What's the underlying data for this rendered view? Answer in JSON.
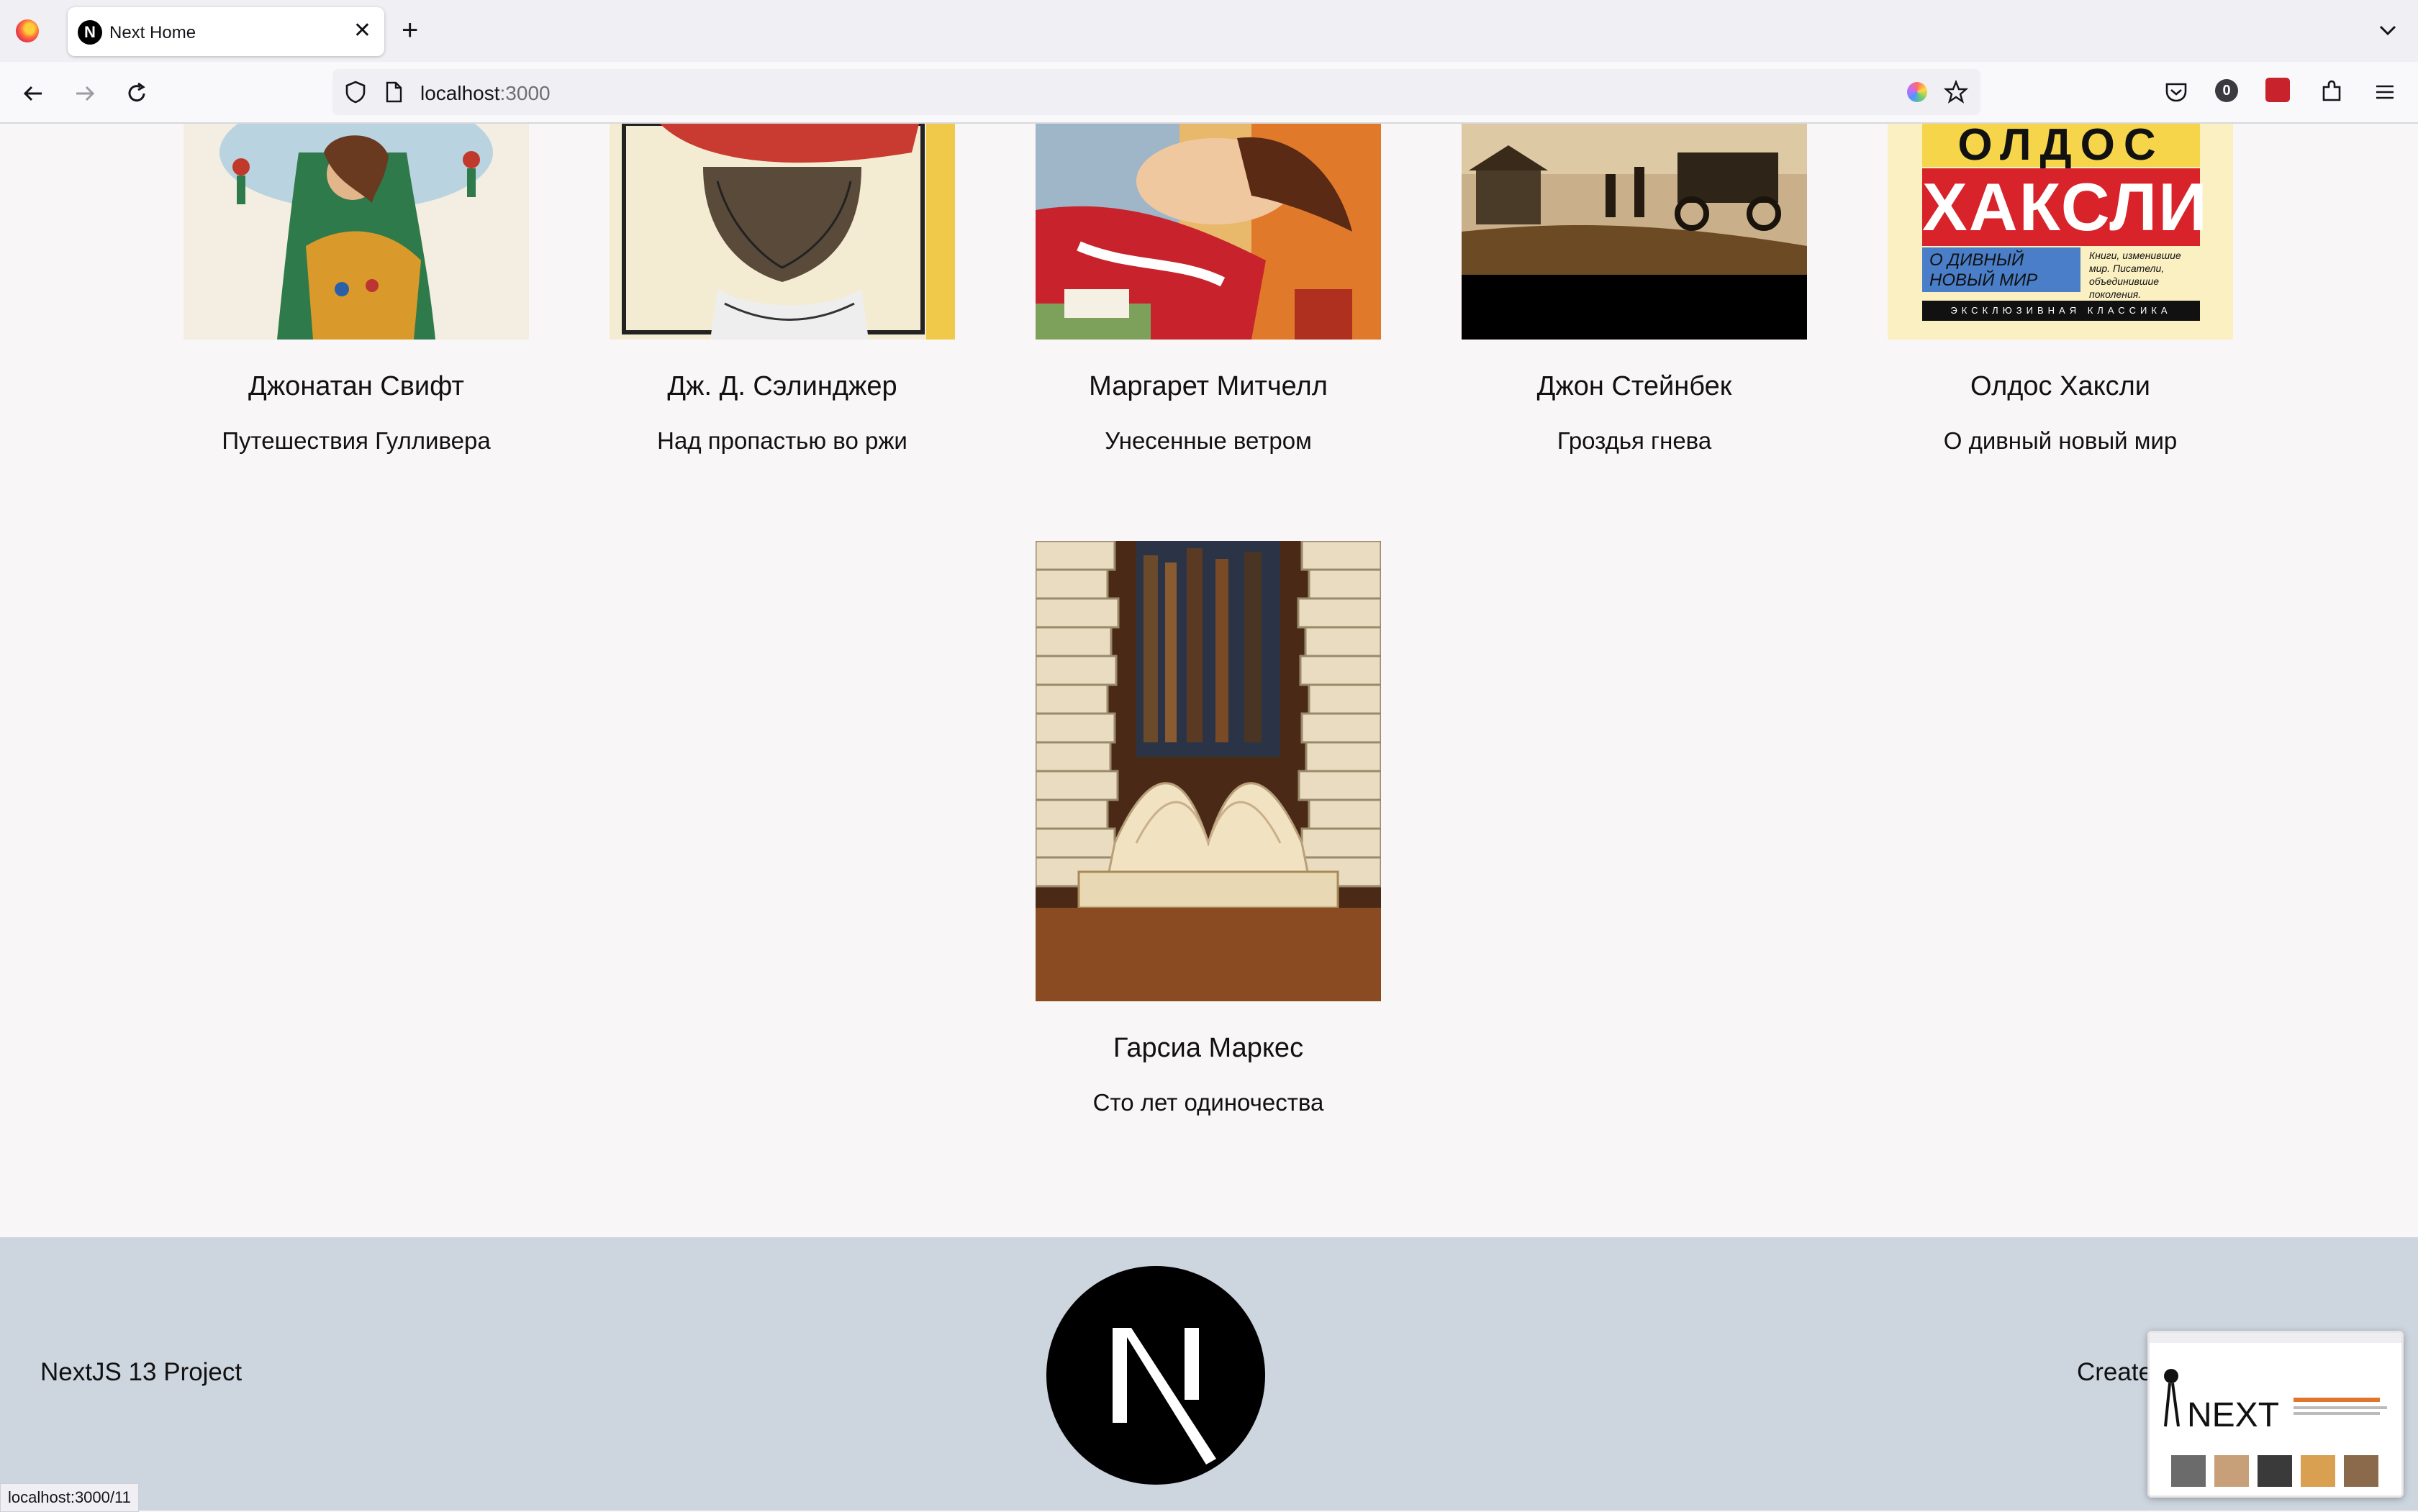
{
  "browser": {
    "tab_title": "Next Home",
    "url_host": "localhost",
    "url_port": ":3000",
    "extension_badge": "0",
    "status_url": "localhost:3000/11"
  },
  "icons": [
    "firefox-logo-icon",
    "next-favicon-icon",
    "close-icon",
    "plus-icon",
    "chevron-down-icon",
    "back-icon",
    "forward-icon",
    "reload-icon",
    "shield-icon",
    "page-icon",
    "color-extension-icon",
    "star-icon",
    "pocket-icon",
    "extensions-icon",
    "menu-icon"
  ],
  "books": [
    {
      "author": "Джонатан Свифт",
      "title": "Путешествия Гулливера"
    },
    {
      "author": "Дж. Д. Сэлинджер",
      "title": "Над пропастью во ржи"
    },
    {
      "author": "Маргарет Митчелл",
      "title": "Унесенные ветром"
    },
    {
      "author": "Джон Стейнбек",
      "title": "Гроздья гнева"
    },
    {
      "author": "Олдос Хаксли",
      "title": "О дивный новый мир"
    },
    {
      "author": "Гарсиа Маркес",
      "title": "Сто лет одиночества"
    }
  ],
  "cover_text": {
    "huxley_top": "ОЛДОС",
    "huxley_name": "ХАКСЛИ",
    "huxley_title": "О ДИВНЫЙ НОВЫЙ МИР",
    "huxley_blurb": "Книги, изменившие мир. Писатели, объединившие поколения.",
    "huxley_series": "ЭКСКЛЮЗИВНАЯ КЛАССИКА"
  },
  "footer": {
    "left_text": "NextJS 13 Project",
    "right_text": "Create"
  },
  "colors": {
    "page_bg": "#f8f6f6",
    "footer_bg": "#cdd5df",
    "huxley_red": "#d8232a",
    "huxley_yellow": "#f6d54a"
  }
}
